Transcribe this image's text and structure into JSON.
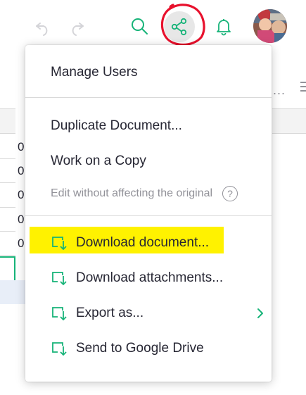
{
  "toolbar": {
    "undo_icon": "undo-icon",
    "redo_icon": "redo-icon",
    "search_icon": "search-icon",
    "share_icon": "share-icon",
    "bell_icon": "bell-icon",
    "accent_color": "#16b378",
    "annotation_color": "#e8112d"
  },
  "menu": {
    "manage_users": "Manage Users",
    "duplicate_document": "Duplicate Document...",
    "work_on_copy": "Work on a Copy",
    "work_on_copy_hint": "Edit without affecting the original",
    "help_glyph": "?",
    "download_document": "Download document...",
    "download_attachments": "Download attachments...",
    "export_as": "Export as...",
    "send_to_drive": "Send to Google Drive",
    "highlight_color": "#fff200"
  },
  "background": {
    "cells": [
      "0",
      "0",
      "0",
      "0",
      "0"
    ],
    "more_label": "..."
  }
}
